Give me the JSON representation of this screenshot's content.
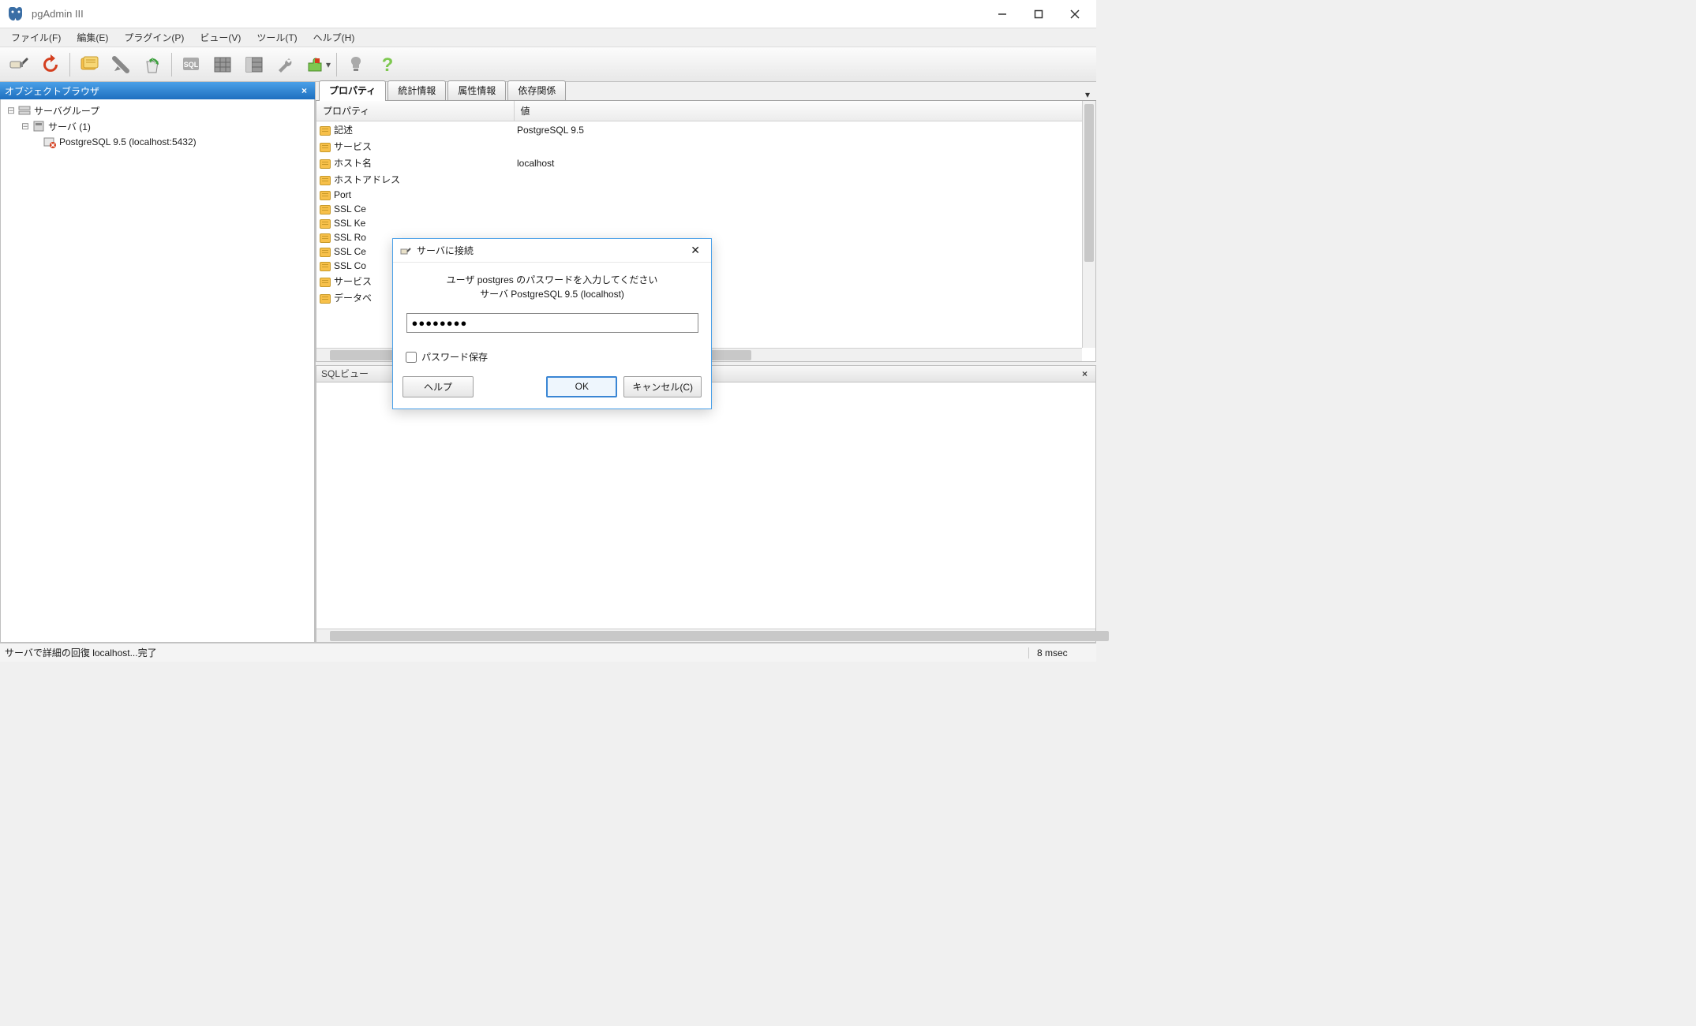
{
  "title": "pgAdmin III",
  "menu": {
    "file": "ファイル(F)",
    "edit": "編集(E)",
    "plugin": "プラグイン(P)",
    "view": "ビュー(V)",
    "tool": "ツール(T)",
    "help": "ヘルプ(H)"
  },
  "browser": {
    "header": "オブジェクトブラウザ",
    "nodes": {
      "root": "サーバグループ",
      "servers": "サーバ (1)",
      "server0": "PostgreSQL 9.5 (localhost:5432)"
    }
  },
  "tabs": {
    "properties": "プロパティ",
    "stats": "統計情報",
    "attrs": "属性情報",
    "deps": "依存関係"
  },
  "prop_headers": {
    "name": "プロパティ",
    "value": "値"
  },
  "props": [
    {
      "name": "記述",
      "value": "PostgreSQL 9.5"
    },
    {
      "name": "サービス",
      "value": ""
    },
    {
      "name": "ホスト名",
      "value": "localhost"
    },
    {
      "name": "ホストアドレス",
      "value": ""
    },
    {
      "name": "Port",
      "value": ""
    },
    {
      "name": "SSL Ce",
      "value": ""
    },
    {
      "name": "SSL Ke",
      "value": ""
    },
    {
      "name": "SSL Ro",
      "value": ""
    },
    {
      "name": "SSL Ce",
      "value": ""
    },
    {
      "name": "SSL Co",
      "value": ""
    },
    {
      "name": "サービス",
      "value": ""
    },
    {
      "name": "データベ",
      "value": ""
    }
  ],
  "sql_header": "SQLビュー",
  "status": {
    "left": "サーバで詳細の回復 localhost...完了",
    "right": "8 msec"
  },
  "dialog": {
    "title": "サーバに接続",
    "line1": "ユーザ postgres のパスワードを入力してください",
    "line2": "サーバ PostgreSQL 9.5 (localhost)",
    "password": "●●●●●●●●",
    "save_pw": "パスワード保存",
    "help": "ヘルプ",
    "ok": "OK",
    "cancel": "キャンセル(C)"
  }
}
